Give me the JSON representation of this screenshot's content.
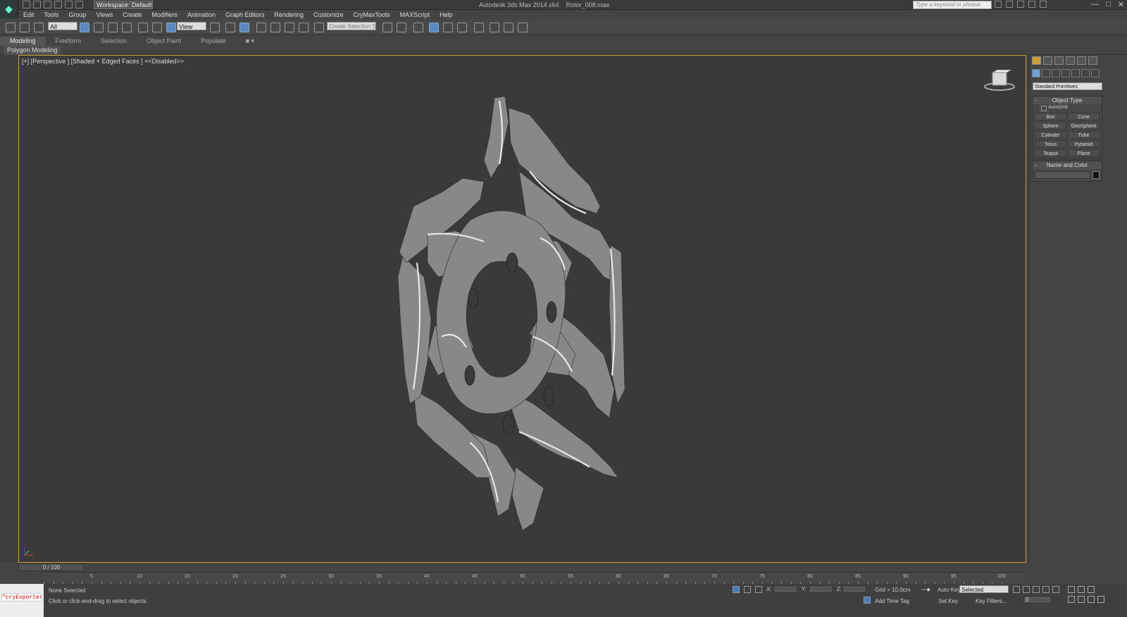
{
  "app": {
    "title": "Autodesk 3ds Max  2014 x64",
    "file": "Rotor_008.max",
    "workspace": "Workspace: Default"
  },
  "search": {
    "placeholder": "Type a keyword or phrase"
  },
  "menu": [
    "Edit",
    "Tools",
    "Group",
    "Views",
    "Create",
    "Modifiers",
    "Animation",
    "Graph Editors",
    "Rendering",
    "Customize",
    "CryMaxTools",
    "MAXScript",
    "Help"
  ],
  "toolbar": {
    "selection_filter": "All",
    "reference_coord": "View",
    "named_selection": "Create Selection Se"
  },
  "ribbon": {
    "tabs": [
      "Modeling",
      "Freeform",
      "Selection",
      "Object Paint",
      "Populate"
    ],
    "panel": "Polygon Modeling"
  },
  "viewport": {
    "label": "[+] [Perspective ] [Shaded + Edged Faces ]  <<Disabled>>"
  },
  "command_panel": {
    "category": "Standard Primitives",
    "object_type_title": "Object Type",
    "autogrid": "AutoGrid",
    "buttons": [
      "Box",
      "Cone",
      "Sphere",
      "GeoSphere",
      "Cylinder",
      "Tube",
      "Torus",
      "Pyramid",
      "Teapot",
      "Plane"
    ],
    "name_color_title": "Name and Color"
  },
  "timeline": {
    "slider": "0 / 100",
    "ticks": [
      "5",
      "10",
      "15",
      "20",
      "25",
      "30",
      "35",
      "40",
      "45",
      "50",
      "55",
      "60",
      "65",
      "70",
      "75",
      "80",
      "85",
      "90",
      "95",
      "100"
    ]
  },
  "status": {
    "listener": "\"cryExporter.",
    "selection": "None Selected",
    "prompt": "Click or click-and-drag to select objects",
    "x_label": "X:",
    "y_label": "Y:",
    "z_label": "Z:",
    "grid": "Grid = 10.0cm",
    "add_time_tag": "Add Time Tag",
    "auto_key": "Auto Key",
    "set_key": "Set Key",
    "key_mode": "Selected",
    "key_filters": "Key Filters...",
    "frame": "0"
  },
  "colors": {
    "viewport_bg": "#3b3a39",
    "viewport_border": "#c8a431",
    "mesh": "#8a8886",
    "highlight": "#5a88c0"
  }
}
